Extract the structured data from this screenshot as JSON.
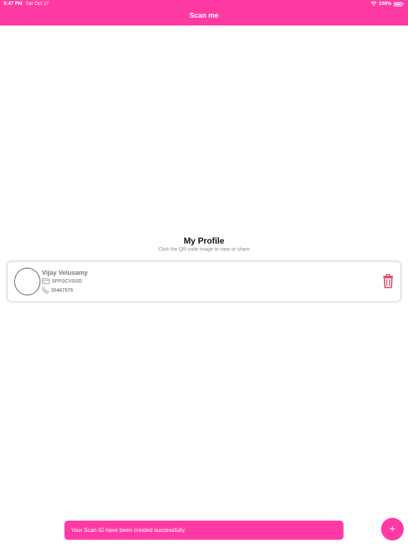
{
  "status_bar": {
    "time": "5:47 PM",
    "date": "Sat Oct 17",
    "battery": "100%"
  },
  "header": {
    "title": "Scan me",
    "color": "#ff3aa4"
  },
  "profile": {
    "heading": "My Profile",
    "subtitle": "Click the QR code image to view or share",
    "card": {
      "name": "Vijay Velusamy",
      "id": "SFFGCVSSD",
      "phone": "35467575"
    }
  },
  "toast": {
    "message": "Your Scan ID have been created successfully."
  },
  "fab": {
    "label": "+"
  }
}
